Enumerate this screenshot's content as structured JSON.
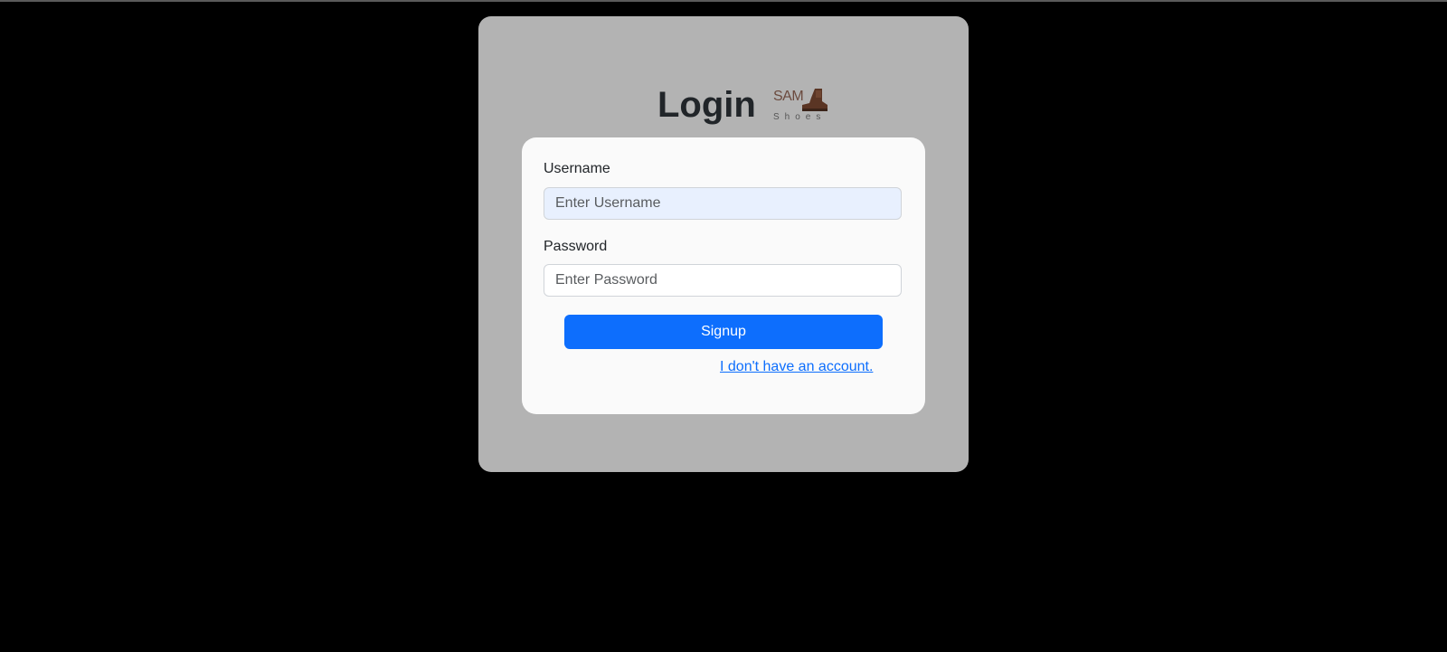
{
  "page": {
    "title": "Login",
    "logo": {
      "brand": "SAM",
      "tagline": "Shoes",
      "icon": "boot-icon"
    }
  },
  "form": {
    "username": {
      "label": "Username",
      "placeholder": "Enter Username",
      "value": ""
    },
    "password": {
      "label": "Password",
      "placeholder": "Enter Password",
      "value": ""
    },
    "submit_label": "Signup",
    "account_link": "I don't have an account."
  },
  "colors": {
    "background": "#000000",
    "panel": "#b3b3b3",
    "card": "#fafafa",
    "primary": "#0d6efd",
    "autofill": "#e8f0fe"
  }
}
